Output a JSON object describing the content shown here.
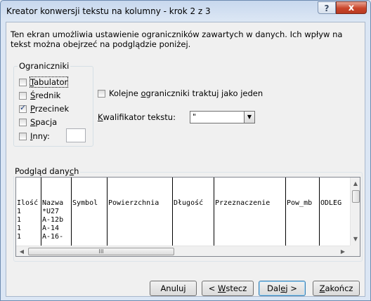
{
  "window": {
    "title": "Kreator konwersji tekstu na kolumny - krok 2 z 3",
    "help_label": "?",
    "close_label": "x"
  },
  "description": "Ten ekran umożliwia ustawienie ograniczników zawartych w danych. Ich wpływ na tekst można obejrzeć na podglądzie poniżej.",
  "delimiters": {
    "legend": "Ograniczniki",
    "tab": {
      "label": "Tabulator",
      "checked": false
    },
    "semicolon": {
      "label": "Średnik",
      "checked": false
    },
    "comma": {
      "label": "Przecinek",
      "checked": true
    },
    "space": {
      "label": "Spacja",
      "checked": false
    },
    "other": {
      "label": "Inny:",
      "checked": false,
      "value": ""
    }
  },
  "consecutive": {
    "label": "Kolejne ograniczniki traktuj jako jeden",
    "checked": false
  },
  "qualifier": {
    "label": "Kwalifikator tekstu:",
    "value": "\""
  },
  "preview": {
    "legend": "Podgląd danych",
    "columns": [
      {
        "header": "Ilość",
        "cells": [
          "1",
          "1",
          "1",
          "1"
        ]
      },
      {
        "header": "Nazwa",
        "cells": [
          "*U27",
          "A-12b",
          "A-14",
          "A-16-"
        ]
      },
      {
        "header": "Symbol",
        "cells": [
          "",
          "",
          "",
          ""
        ]
      },
      {
        "header": "Powierzchnia",
        "cells": [
          "",
          "",
          "",
          ""
        ]
      },
      {
        "header": "Długość",
        "cells": [
          "",
          "",
          "",
          ""
        ]
      },
      {
        "header": "Przeznaczenie",
        "cells": [
          "",
          "",
          "",
          ""
        ]
      },
      {
        "header": "Pow_mb",
        "cells": [
          "",
          "",
          "",
          ""
        ]
      },
      {
        "header": "ODLEG",
        "cells": [
          "",
          "",
          "",
          ""
        ]
      }
    ],
    "hscroll_grip": "III"
  },
  "buttons": {
    "cancel": "Anuluj",
    "back": "< Wstecz",
    "next": "Dalej >",
    "finish": "Zakończ"
  }
}
